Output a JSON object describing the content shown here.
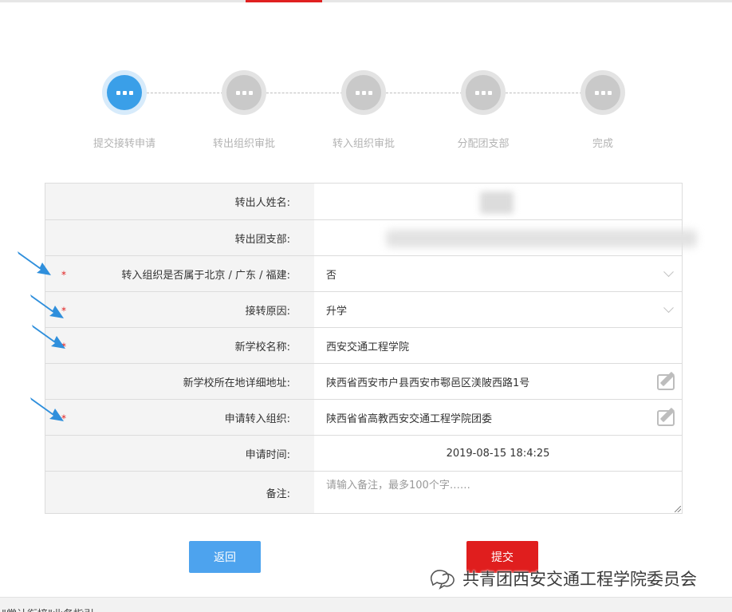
{
  "colors": {
    "accent": "#e02020",
    "primary": "#4da3ee",
    "active_step": "#3a9fe8",
    "inactive_step": "#c9c9c9"
  },
  "steps": [
    {
      "label": "提交接转申请",
      "state": "active"
    },
    {
      "label": "转出组织审批",
      "state": "pending"
    },
    {
      "label": "转入组织审批",
      "state": "pending"
    },
    {
      "label": "分配团支部",
      "state": "pending"
    },
    {
      "label": "完成",
      "state": "pending"
    }
  ],
  "form": {
    "rows": [
      {
        "label": "转出人姓名:",
        "required": false,
        "value": "",
        "redacted": true
      },
      {
        "label": "转出团支部:",
        "required": false,
        "value": "",
        "redacted": true
      },
      {
        "label": "转入组织是否属于北京 / 广东 / 福建:",
        "required": true,
        "value": "否",
        "control": "select"
      },
      {
        "label": "接转原因:",
        "required": true,
        "value": "升学",
        "control": "select"
      },
      {
        "label": "新学校名称:",
        "required": true,
        "value": "西安交通工程学院",
        "control": "input"
      },
      {
        "label": "新学校所在地详细地址:",
        "required": false,
        "value": "陕西省西安市户县西安市鄠邑区渼陂西路1号",
        "control": "edit"
      },
      {
        "label": "申请转入组织:",
        "required": true,
        "value": "陕西省省高教西安交通工程学院团委",
        "control": "edit"
      },
      {
        "label": "申请时间:",
        "required": false,
        "value": "2019-08-15 18:4:25",
        "control": "text"
      },
      {
        "label": "备注:",
        "required": false,
        "value": "",
        "placeholder": "请输入备注，最多100个字……",
        "control": "textarea"
      }
    ],
    "required_mark": "*"
  },
  "buttons": {
    "back": "返回",
    "submit": "提交"
  },
  "watermark": {
    "text": "共青团西安交通工程学院委员会",
    "icon": "wechat-official-account-icon"
  },
  "bottom_text": "\"掌计衔接\"业务指引:"
}
